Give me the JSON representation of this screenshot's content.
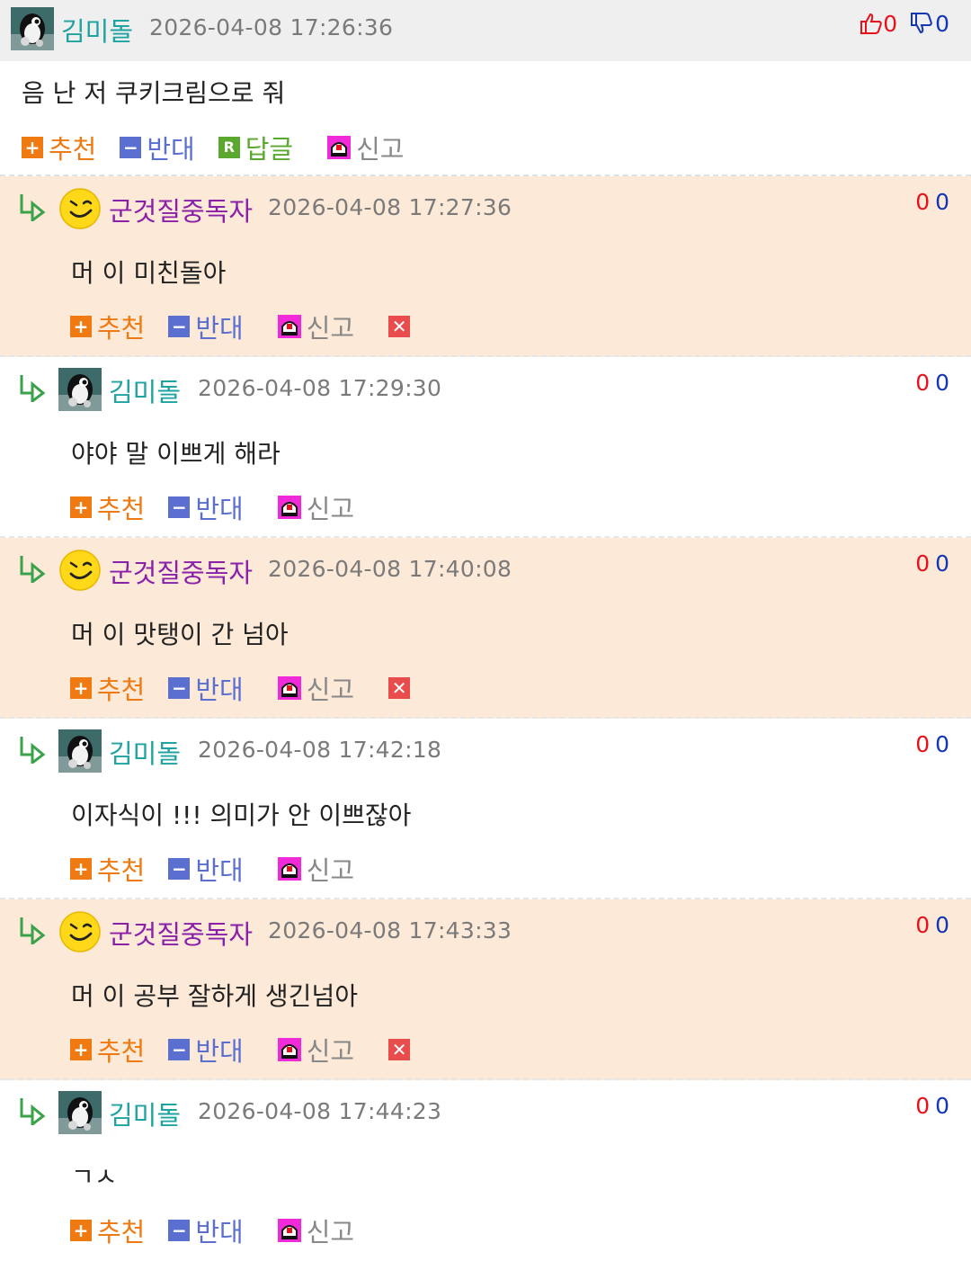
{
  "colors": {
    "teal_nick": "#1fa3a0",
    "purple_nick": "#8a1fa8",
    "reply_bg": "#fce9d8",
    "header_bg": "#efefef",
    "upvote": "#e8111b",
    "downvote": "#1436b3",
    "recommend": "#f07a12",
    "oppose": "#5a6fcf",
    "reply": "#5aa82e",
    "delete": "#e84c4c"
  },
  "actions": {
    "recommend": "추천",
    "oppose": "반대",
    "reply": "답글",
    "report": "신고"
  },
  "top_comment": {
    "nickname": "김미돌",
    "time": "2026-04-08 17:26:36",
    "up": "0",
    "down": "0",
    "text": "음 난 저 쿠키크림으로 줘",
    "avatar_icon": "penguin-avatar-icon"
  },
  "replies": [
    {
      "nickname": "군것질중독자",
      "time": "2026-04-08 17:27:36",
      "up": "0",
      "down": "0",
      "text": "머 이 미친돌아",
      "avatar_icon": "smiley-avatar-icon"
    },
    {
      "nickname": "김미돌",
      "time": "2026-04-08 17:29:30",
      "up": "0",
      "down": "0",
      "text": "야야 말 이쁘게 해라",
      "avatar_icon": "penguin-avatar-icon"
    },
    {
      "nickname": "군것질중독자",
      "time": "2026-04-08 17:40:08",
      "up": "0",
      "down": "0",
      "text": "머 이 맛탱이 간 넘아",
      "avatar_icon": "smiley-avatar-icon"
    },
    {
      "nickname": "김미돌",
      "time": "2026-04-08 17:42:18",
      "up": "0",
      "down": "0",
      "text": "이자식이 !!! 의미가 안 이쁘잖아",
      "avatar_icon": "penguin-avatar-icon"
    },
    {
      "nickname": "군것질중독자",
      "time": "2026-04-08 17:43:33",
      "up": "0",
      "down": "0",
      "text": "머 이 공부 잘하게 생긴넘아",
      "avatar_icon": "smiley-avatar-icon"
    },
    {
      "nickname": "김미돌",
      "time": "2026-04-08 17:44:23",
      "up": "0",
      "down": "0",
      "text": "ㄱㅅ",
      "avatar_icon": "penguin-avatar-icon"
    }
  ]
}
